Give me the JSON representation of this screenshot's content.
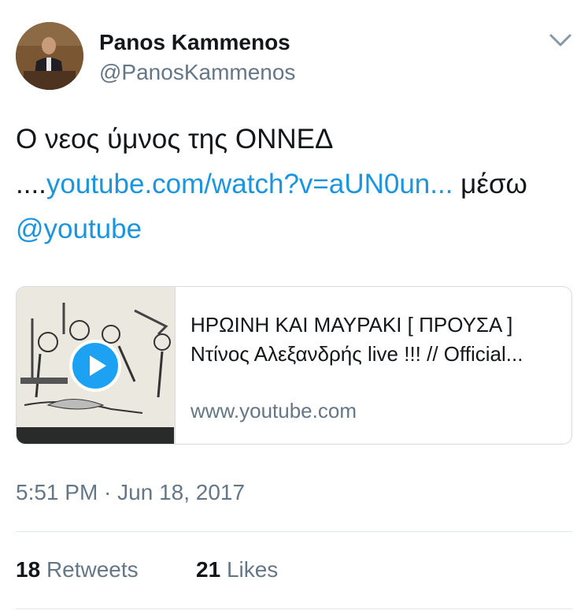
{
  "author": {
    "name": "Panos Kammenos",
    "handle": "@PanosKammenos"
  },
  "tweet": {
    "text_line1": "Ο νεος ύμνος της ΟΝΝΕΔ",
    "text_prefix": "....",
    "link_text": "youtube.com/watch?v=aUN0un...",
    "via_text": " μέσω",
    "mention": "@youtube"
  },
  "card": {
    "title": "ΗΡΩΙΝΗ ΚΑΙ ΜΑΥΡΑΚΙ [ ΠΡΟΥΣΑ ] Ντίνος Αλεξανδρής live !!! // Official...",
    "domain": "www.youtube.com"
  },
  "timestamp": "5:51 PM · Jun 18, 2017",
  "stats": {
    "retweets_count": "18",
    "retweets_label": "Retweets",
    "likes_count": "21",
    "likes_label": "Likes"
  },
  "colors": {
    "link": "#1b95e0",
    "secondary_text": "#657786",
    "play_button": "#1da1f2"
  }
}
